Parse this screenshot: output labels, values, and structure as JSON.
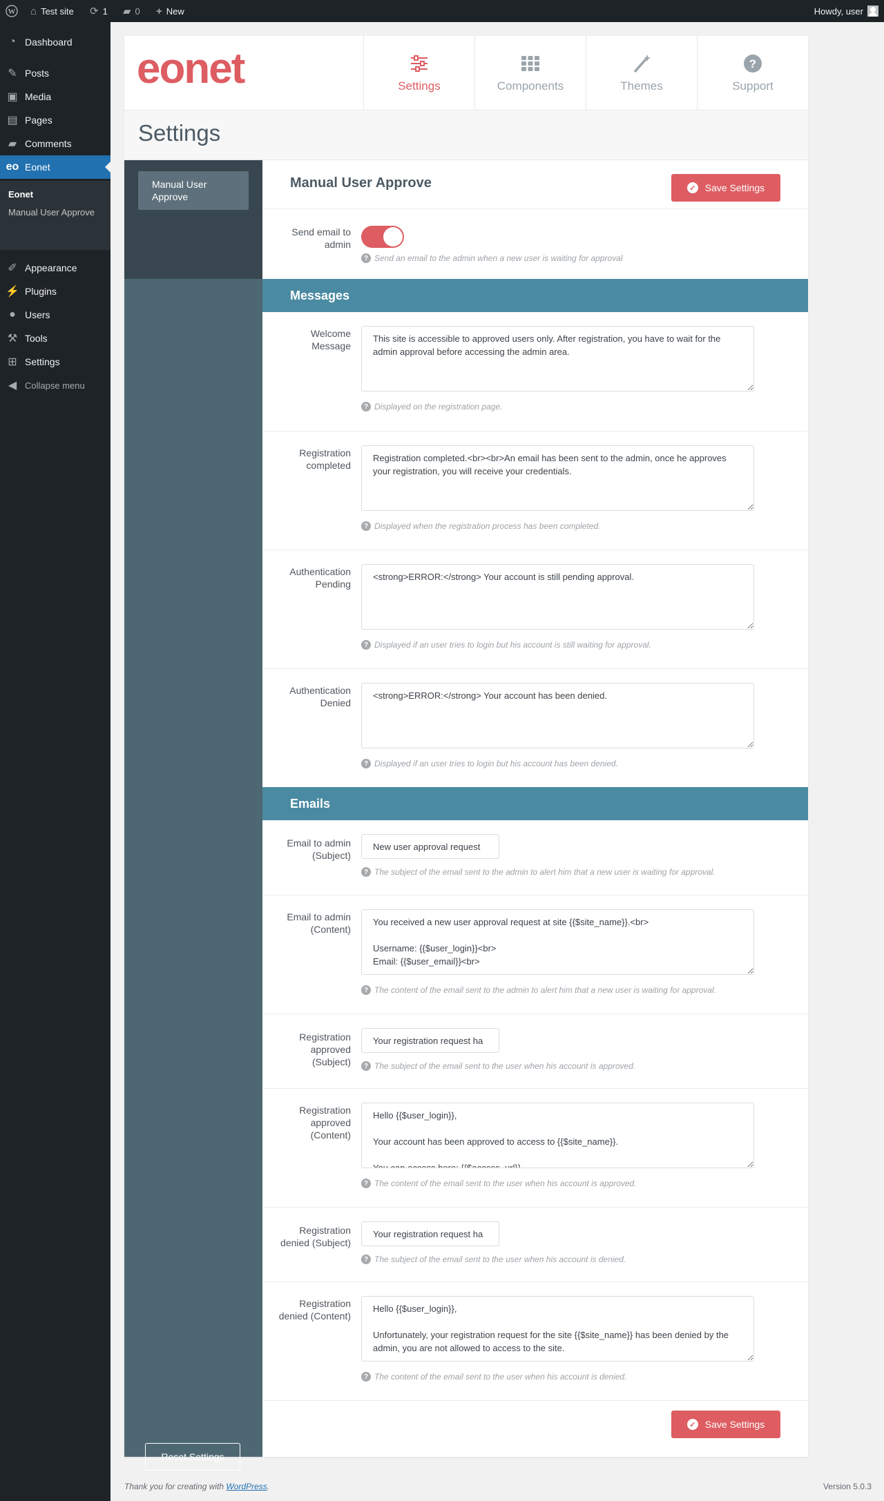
{
  "adminbar": {
    "site_name": "Test site",
    "updates_count": "1",
    "comments_count": "0",
    "new_label": "New",
    "howdy": "Howdy, user"
  },
  "sidebar": {
    "items": [
      {
        "label": "Dashboard",
        "icon": "dashboard-icon"
      },
      {
        "label": "Posts",
        "icon": "pin-icon"
      },
      {
        "label": "Media",
        "icon": "media-icon"
      },
      {
        "label": "Pages",
        "icon": "pages-icon"
      },
      {
        "label": "Comments",
        "icon": "comment-icon"
      },
      {
        "label": "Eonet",
        "icon": "eonet-icon",
        "icon_text": "eo"
      },
      {
        "label": "Appearance",
        "icon": "brush-icon"
      },
      {
        "label": "Plugins",
        "icon": "plugin-icon"
      },
      {
        "label": "Users",
        "icon": "user-icon"
      },
      {
        "label": "Tools",
        "icon": "wrench-icon"
      },
      {
        "label": "Settings",
        "icon": "settings-icon"
      }
    ],
    "submenu": [
      "Eonet",
      "Manual User Approve"
    ],
    "collapse": "Collapse menu"
  },
  "logo": "eonet",
  "nav_tabs": [
    {
      "label": "Settings",
      "icon": "sliders-icon"
    },
    {
      "label": "Components",
      "icon": "grid-icon"
    },
    {
      "label": "Themes",
      "icon": "magic-wand-icon"
    },
    {
      "label": "Support",
      "icon": "question-icon"
    }
  ],
  "page_title": "Settings",
  "sub_tab": "Manual User Approve",
  "section_title": "Manual User Approve",
  "save_label": "Save Settings",
  "reset_label": "Reset Settings",
  "send_email": {
    "label": "Send email to admin",
    "help": "Send an email to the admin when a new user is waiting for approval",
    "enabled": true
  },
  "messages_heading": "Messages",
  "messages": [
    {
      "label": "Welcome Message",
      "value": "This site is accessible to approved users only. After registration, you have to wait for the admin approval before accessing the admin area.",
      "help": "Displayed on the registration page."
    },
    {
      "label": "Registration completed",
      "value": "Registration completed.<br><br>An email has been sent to the admin, once he approves your registration, you will receive your credentials.",
      "help": "Displayed when the registration process has been completed."
    },
    {
      "label": "Authentication Pending",
      "value": "<strong>ERROR:</strong> Your account is still pending approval.",
      "help": "Displayed if an user tries to login but his account is still waiting for approval."
    },
    {
      "label": "Authentication Denied",
      "value": "<strong>ERROR:</strong> Your account has been denied.",
      "help": "Displayed if an user tries to login but his account has been denied."
    }
  ],
  "emails_heading": "Emails",
  "emails": [
    {
      "label": "Email to admin (Subject)",
      "type": "input",
      "value": "New user approval request",
      "help": "The subject of the email sent to the admin to alert him that a new user is waiting for approval."
    },
    {
      "label": "Email to admin (Content)",
      "type": "textarea",
      "value": "You received a new user approval request at site {{$site_name}}.<br>\n\nUsername: {{$user_login}}<br>\nEmail: {{$user_email}}<br>",
      "help": "The content of the email sent to the admin to alert him that a new user is waiting for approval."
    },
    {
      "label": "Registration approved (Subject)",
      "type": "input",
      "value": "Your registration request ha",
      "help": "The subject of the email sent to the user when his account is approved."
    },
    {
      "label": "Registration approved (Content)",
      "type": "textarea",
      "value": "Hello {{$user_login}},\n\nYour account has been approved to access to {{$site_name}}.\n\nYou can access here: {{$access_url}}",
      "help": "The content of the email sent to the user when his account is approved."
    },
    {
      "label": "Registration denied (Subject)",
      "type": "input",
      "value": "Your registration request ha",
      "help": "The subject of the email sent to the user when his account is denied."
    },
    {
      "label": "Registration denied (Content)",
      "type": "textarea",
      "value": "Hello {{$user_login}},\n\nUnfortunately, your registration request for the site {{$site_name}} has been denied by the admin, you are not allowed to access to the site.",
      "help": "The content of the email sent to the user when his account is denied."
    }
  ],
  "footer": {
    "thanks": "Thank you for creating with",
    "link": "WordPress",
    "period": ".",
    "version": "Version 5.0.3"
  },
  "colors": {
    "accent": "#dd5d62",
    "band": "#4a8aa2",
    "wp_blue": "#2271b1",
    "sidebar": "#1d2327"
  }
}
